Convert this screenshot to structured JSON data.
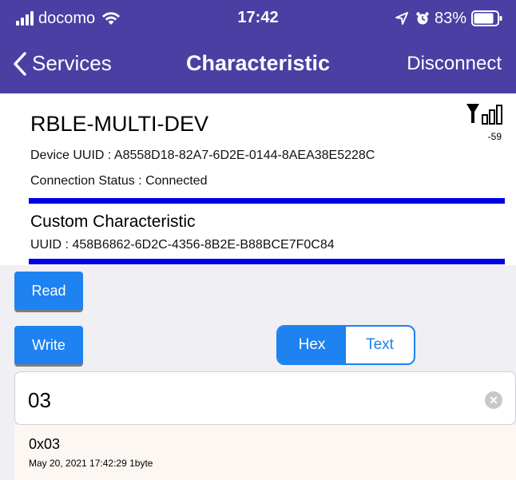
{
  "status_bar": {
    "carrier": "docomo",
    "time": "17:42",
    "battery": "83%"
  },
  "nav": {
    "back_label": "Services",
    "title": "Characteristic",
    "right_button": "Disconnect"
  },
  "device": {
    "name": "RBLE-MULTI-DEV",
    "rssi": "-59",
    "uuid_line": "Device UUID : A8558D18-82A7-6D2E-0144-8AEA38E5228C",
    "connection_line": "Connection Status :   Connected"
  },
  "characteristic": {
    "name": "Custom Characteristic",
    "uuid_line": "UUID : 458B6862-6D2C-4356-8B2E-B88BCE7F0C84"
  },
  "actions": {
    "read_label": "Read",
    "write_label": "Write",
    "segment": {
      "options": [
        "Hex",
        "Text"
      ],
      "selected": "Hex"
    }
  },
  "input": {
    "value": "03"
  },
  "log": {
    "value": "0x03",
    "meta": "May 20, 2021 17:42:29   1byte"
  },
  "colors": {
    "nav_bg": "#4b3fa3",
    "accent": "#1e82f0",
    "separator": "#0000e6"
  }
}
